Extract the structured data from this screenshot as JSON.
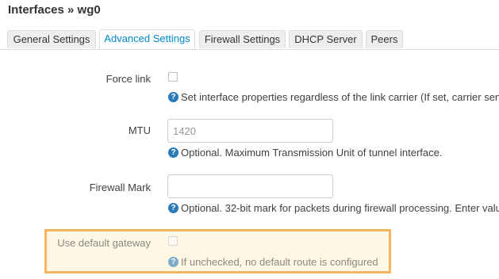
{
  "page": {
    "title": "Interfaces » wg0"
  },
  "tabs": [
    {
      "label": "General Settings",
      "active": false
    },
    {
      "label": "Advanced Settings",
      "active": true
    },
    {
      "label": "Firewall Settings",
      "active": false
    },
    {
      "label": "DHCP Server",
      "active": false
    },
    {
      "label": "Peers",
      "active": false
    }
  ],
  "fields": {
    "force_link": {
      "label": "Force link",
      "checked": false,
      "help": "Set interface properties regardless of the link carrier (If set, carrier sen"
    },
    "mtu": {
      "label": "MTU",
      "value": "",
      "placeholder": "1420",
      "help": "Optional. Maximum Transmission Unit of tunnel interface."
    },
    "firewall_mark": {
      "label": "Firewall Mark",
      "value": "",
      "placeholder": "",
      "help": "Optional. 32-bit mark for packets during firewall processing. Enter valu"
    },
    "default_gateway": {
      "label": "Use default gateway",
      "checked": false,
      "disabled": true,
      "help": "If unchecked, no default route is configured"
    }
  },
  "colors": {
    "accent": "#0088cc",
    "help_icon": "#2a7ab8",
    "highlight_border": "#f5b75d",
    "highlight_fill": "#fdf7e3"
  },
  "icons": {
    "help": "question-circle-icon"
  }
}
